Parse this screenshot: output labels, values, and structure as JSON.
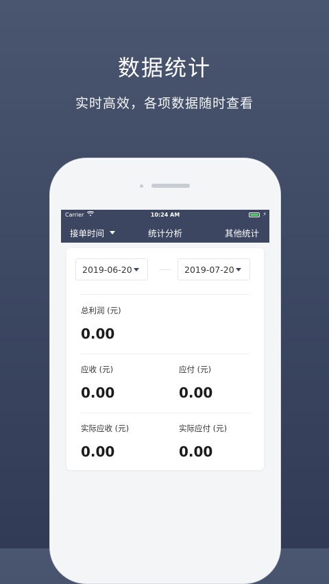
{
  "hero": {
    "title": "数据统计",
    "subtitle": "实时高效，各项数据随时查看"
  },
  "status_bar": {
    "carrier": "Carrier",
    "time": "10:24 AM",
    "battery_color": "#4cd964"
  },
  "nav": {
    "left_label": "接单时间",
    "title": "统计分析",
    "right_label": "其他统计"
  },
  "date_range": {
    "start": "2019-06-20",
    "end": "2019-07-20"
  },
  "stats": {
    "total_profit_label": "总利润 (元)",
    "total_profit_value": "0.00",
    "receivable_label": "应收 (元)",
    "receivable_value": "0.00",
    "payable_label": "应付 (元)",
    "payable_value": "0.00",
    "actual_receivable_label": "实际应收 (元)",
    "actual_receivable_value": "0.00",
    "actual_payable_label": "实际应付 (元)",
    "actual_payable_value": "0.00"
  },
  "colors": {
    "accent_nav": "#3c4660",
    "background": "#4a5670"
  }
}
